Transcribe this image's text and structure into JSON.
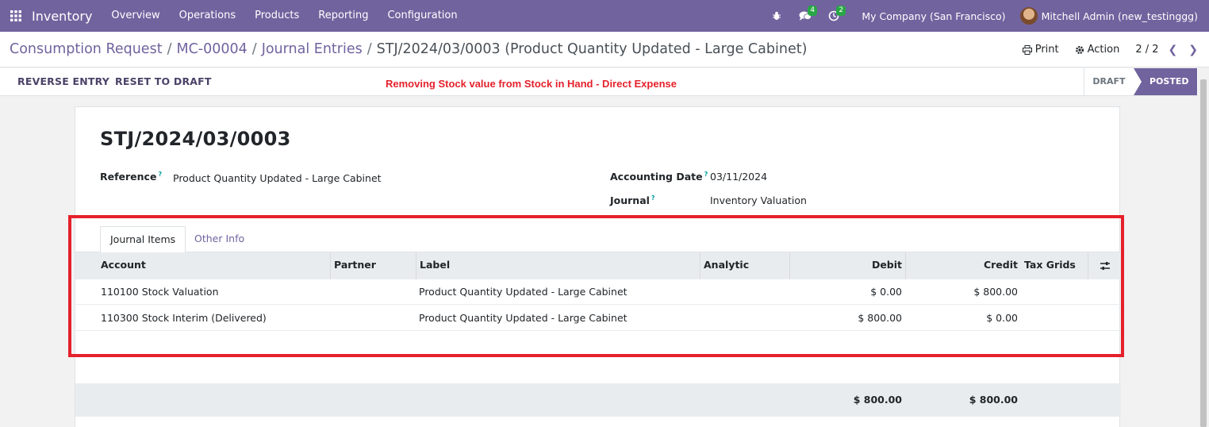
{
  "navbar": {
    "app_name": "Inventory",
    "menu": [
      "Overview",
      "Operations",
      "Products",
      "Reporting",
      "Configuration"
    ],
    "messages_count": "4",
    "activities_count": "2",
    "company": "My Company (San Francisco)",
    "user": "Mitchell Admin (new_testinggg)"
  },
  "breadcrumb": {
    "items": [
      "Consumption Request",
      "MC-00004",
      "Journal Entries"
    ],
    "sep": "/",
    "current": "STJ/2024/03/0003 (Product Quantity Updated - Large Cabinet)"
  },
  "actions": {
    "print": "Print",
    "action": "Action",
    "pager": "2 / 2"
  },
  "statusbar": {
    "reverse": "REVERSE ENTRY",
    "reset": "RESET TO DRAFT",
    "annotation": "Removing Stock value from Stock in Hand - Direct Expense",
    "stages": [
      "DRAFT",
      "POSTED"
    ],
    "active_stage": "POSTED"
  },
  "form": {
    "title": "STJ/2024/03/0003",
    "reference_label": "Reference",
    "reference_value": "Product Quantity Updated - Large Cabinet",
    "date_label": "Accounting Date",
    "date_value": "03/11/2024",
    "journal_label": "Journal",
    "journal_value": "Inventory Valuation",
    "help_mark": "?"
  },
  "tabs": [
    "Journal Items",
    "Other Info"
  ],
  "table": {
    "columns": [
      "Account",
      "Partner",
      "Label",
      "Analytic",
      "Debit",
      "Credit",
      "Tax Grids"
    ],
    "rows": [
      {
        "account": "110100 Stock Valuation",
        "partner": "",
        "label": "Product Quantity Updated - Large Cabinet",
        "analytic": "",
        "debit": "$ 0.00",
        "credit": "$ 800.00",
        "tax": ""
      },
      {
        "account": "110300 Stock Interim (Delivered)",
        "partner": "",
        "label": "Product Quantity Updated - Large Cabinet",
        "analytic": "",
        "debit": "$ 800.00",
        "credit": "$ 0.00",
        "tax": ""
      }
    ],
    "total_debit": "$ 800.00",
    "total_credit": "$ 800.00"
  },
  "colors": {
    "brand": "#71639e",
    "annotation": "#e5212b"
  }
}
